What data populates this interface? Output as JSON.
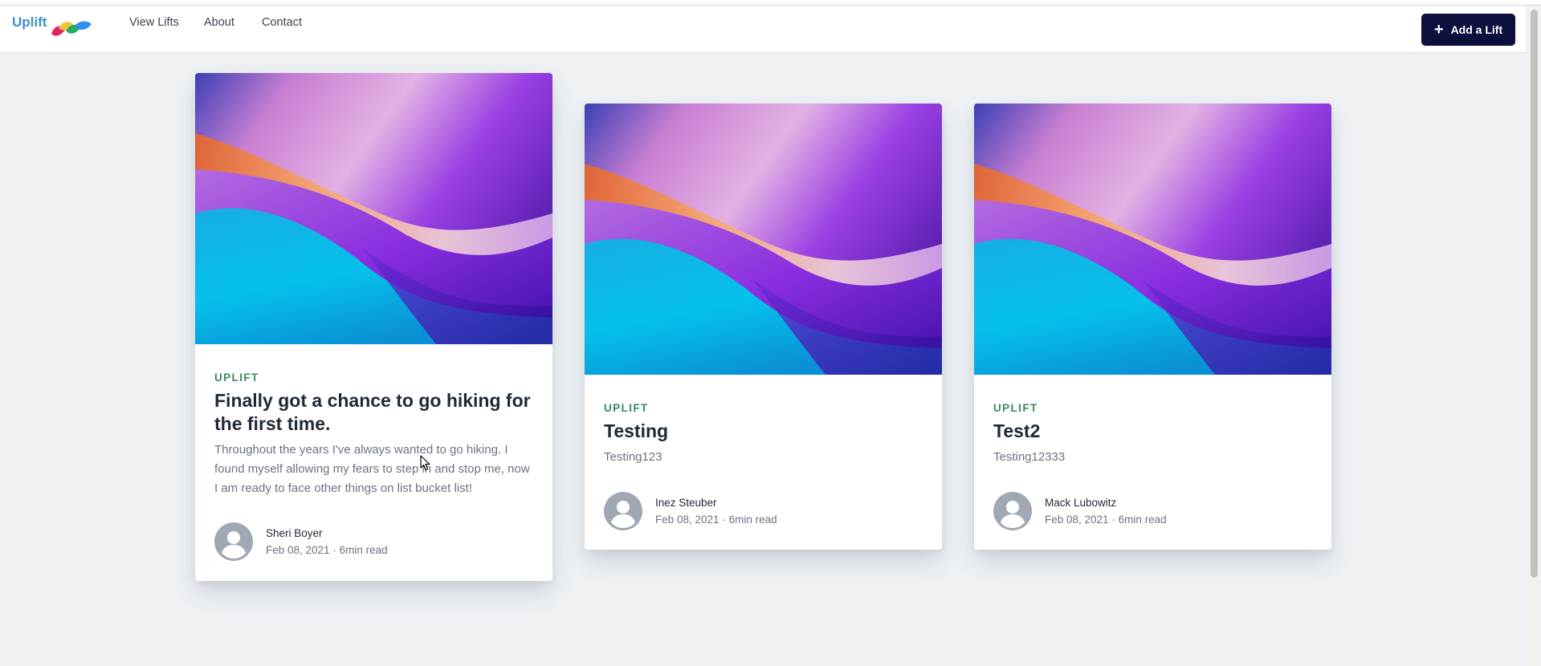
{
  "brand": {
    "name": "Uplift"
  },
  "nav": {
    "items": [
      "View Lifts",
      "About",
      "Contact"
    ]
  },
  "add_button": {
    "label": "Add a Lift",
    "icon": "plus-icon"
  },
  "cards": [
    {
      "category": "UPLIFT",
      "title": "Finally got a chance to go hiking for the first time.",
      "excerpt": "Throughout the years I've always wanted to go hiking. I found myself allowing my fears to step in and stop me, now I am ready to face other things on list bucket list!",
      "author": "Sheri Boyer",
      "date": "Feb 08, 2021",
      "read_time": "6min read"
    },
    {
      "category": "UPLIFT",
      "title": "Testing",
      "excerpt": "Testing123",
      "author": "Inez Steuber",
      "date": "Feb 08, 2021",
      "read_time": "6min read"
    },
    {
      "category": "UPLIFT",
      "title": "Test2",
      "excerpt": "Testing12333",
      "author": "Mack Lubowitz",
      "date": "Feb 08, 2021",
      "read_time": "6min read"
    }
  ],
  "colors": {
    "brand": "#3e8fc4",
    "button": "#0d0f3d",
    "category": "#3a8a5e",
    "background": "#eef2f5"
  }
}
